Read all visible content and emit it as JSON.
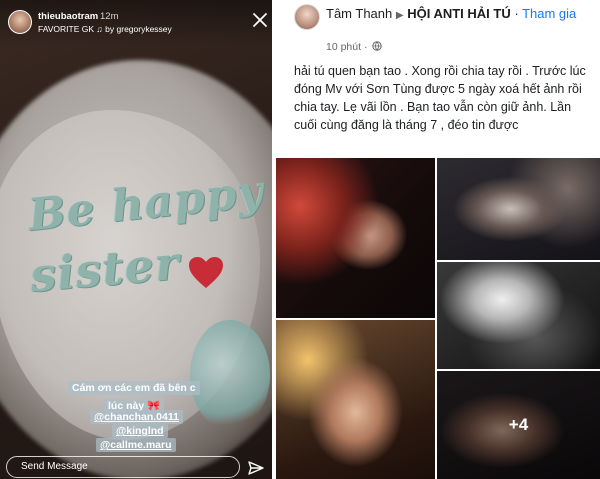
{
  "story": {
    "username": "thieubaotram",
    "time": "12m",
    "favorite_label": "FAVORITE GK",
    "music_prefix": "♫",
    "music_label": "by gregorykessey",
    "cake_line1": "Be happy",
    "cake_line2": "sister",
    "caption_line1": "Cám ơn các em đã bên c",
    "caption_line2": "lúc này 🎀",
    "mentions": [
      "@chanchan.0411",
      "@kinglnd",
      "@callme.maru"
    ],
    "send_placeholder": "Send Message"
  },
  "post": {
    "author": "Tâm Thanh",
    "group_arrow": "▶",
    "group": "HỘI ANTI HẢI TÚ",
    "join": "Tham gia",
    "time": "10 phút",
    "separator": "·",
    "text": "hải tú quen bạn tao . Xong rồi chia tay rồi . Trước lúc đóng Mv với Sơn Tùng được 5 ngày xoá hết ảnh rồi chia tay. Lẹ vãi lồn . Bạn tao vẫn còn giữ ảnh. Lần cuối cùng đăng là tháng 7 , đéo tin được",
    "more_photos": "+4"
  },
  "icons": {
    "close": "close-icon",
    "send": "paper-plane-icon",
    "globe": "globe-icon",
    "heart": "heart-icon"
  },
  "colors": {
    "fb_blue": "#1877f2",
    "caption_bg": "#aabec8",
    "frosting": "#8fb3ab",
    "heart": "#c8202a"
  }
}
